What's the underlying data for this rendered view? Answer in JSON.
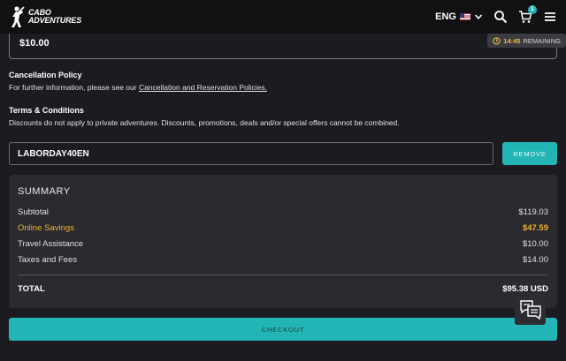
{
  "header": {
    "logo_line1": "CABO",
    "logo_line2": "ADVENTURES",
    "language": "ENG",
    "cart_count": "1",
    "icons": [
      "logo-figure-icon",
      "flag-us-icon",
      "chevron-down-icon",
      "search-icon",
      "cart-icon",
      "menu-icon"
    ]
  },
  "amount": {
    "value": "$10.00"
  },
  "timer": {
    "time": "14:45",
    "label": "REMAINING"
  },
  "cancellation": {
    "title": "Cancellation Policy",
    "text": "For further information, please see our ",
    "link": "Cancellation and Reservation Policies."
  },
  "terms": {
    "title": "Terms & Conditions",
    "text": "Discounts do not apply to private adventures. Discounts, promotions, deals and/or special offers cannot be combined."
  },
  "coupon": {
    "value": "LABORDAY40EN",
    "remove_label": "REMOVE"
  },
  "summary": {
    "heading": "SUMMARY",
    "rows": [
      {
        "label": "Subtotal",
        "value": "$119.03"
      },
      {
        "label": "Online Savings",
        "value": "$47.59"
      },
      {
        "label": "Travel Assistance",
        "value": "$10.00"
      },
      {
        "label": "Taxes and Fees",
        "value": "$14.00"
      }
    ],
    "total_label": "TOTAL",
    "total_value": "$95.38 USD"
  },
  "checkout_label": "CHECKOUT",
  "colors": {
    "accent": "#23b5b5",
    "savings": "#f0b429",
    "background": "#1c1c20",
    "panel": "#2a2a30"
  }
}
